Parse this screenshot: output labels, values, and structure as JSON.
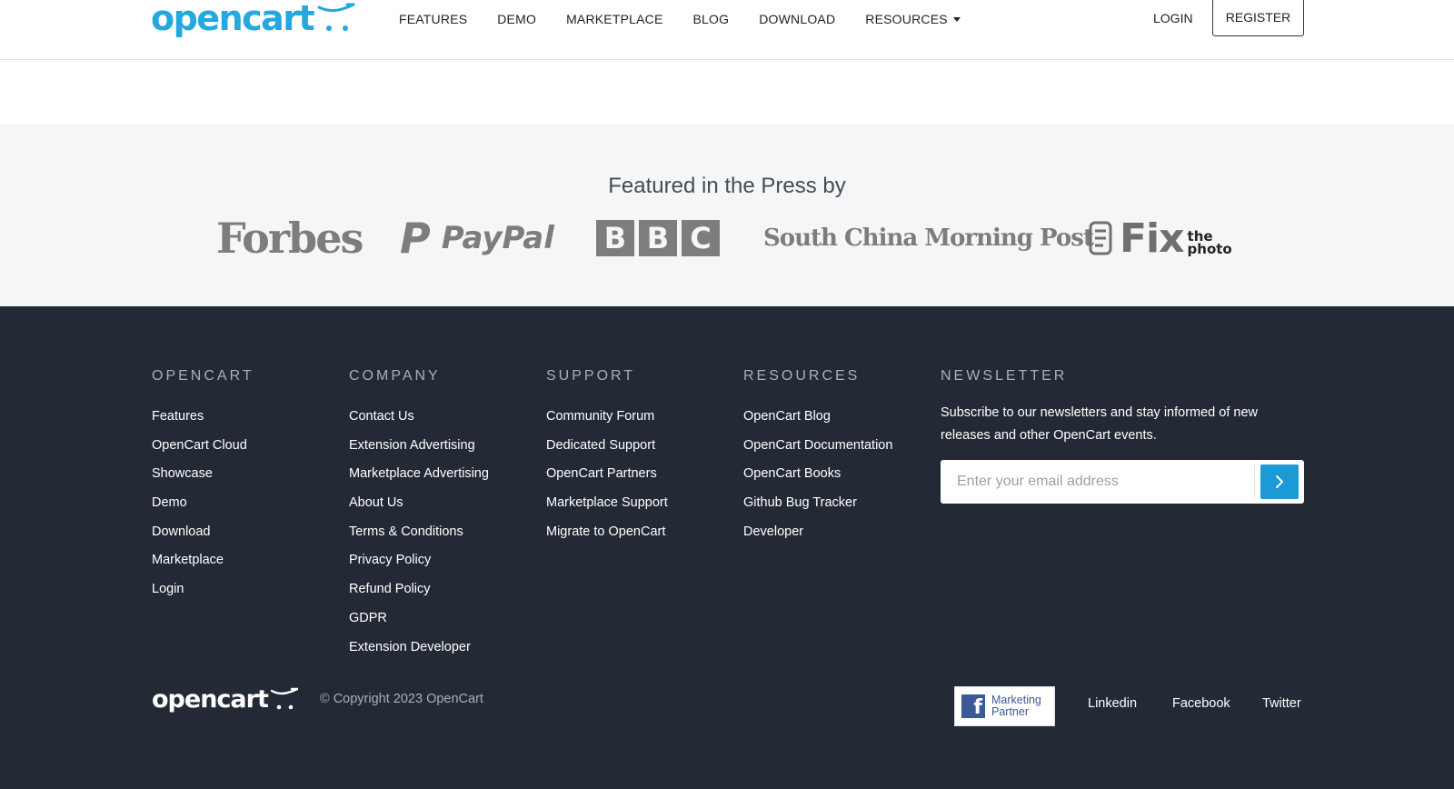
{
  "header": {
    "logo_text": "opencart",
    "nav": [
      "FEATURES",
      "DEMO",
      "MARKETPLACE",
      "BLOG",
      "DOWNLOAD",
      "RESOURCES"
    ],
    "login_label": "LOGIN",
    "register_label": "REGISTER"
  },
  "press": {
    "title": "Featured in the Press by",
    "forbes": "Forbes",
    "paypal": "PayPal",
    "paypal_mark": "P",
    "bbc": [
      "B",
      "B",
      "C"
    ],
    "scmp": "South China Morning Post",
    "fix_word": "Fix",
    "fix_small_1": "the",
    "fix_small_2": "photo"
  },
  "footer": {
    "columns": [
      {
        "title": "OPENCART",
        "links": [
          "Features",
          "OpenCart Cloud",
          "Showcase",
          "Demo",
          "Download",
          "Marketplace",
          "Login"
        ]
      },
      {
        "title": "COMPANY",
        "links": [
          "Contact Us",
          "Extension Advertising",
          "Marketplace Advertising",
          "About Us",
          "Terms & Conditions",
          "Privacy Policy",
          "Refund Policy",
          "GDPR",
          "Extension Developer"
        ]
      },
      {
        "title": "SUPPORT",
        "links": [
          "Community Forum",
          "Dedicated Support",
          "OpenCart Partners",
          "Marketplace Support",
          "Migrate to OpenCart"
        ]
      },
      {
        "title": "RESOURCES",
        "links": [
          "OpenCart Blog",
          "OpenCart Documentation",
          "OpenCart Books",
          "Github Bug Tracker",
          "Developer"
        ]
      }
    ],
    "newsletter": {
      "title": "NEWSLETTER",
      "text": "Subscribe to our newsletters and stay informed of new releases and other OpenCart events.",
      "placeholder": "Enter your email address"
    },
    "logo_text": "opencart",
    "copyright": "© Copyright 2023 OpenCart",
    "fb_badge": {
      "mark": "f",
      "line1": "Marketing",
      "line2": "Partner"
    },
    "social": [
      "Linkedin",
      "Facebook",
      "Twitter"
    ]
  },
  "colors": {
    "brand_blue": "#23a8e0",
    "footer_bg": "#242a35",
    "press_bg": "#f5f6f7",
    "button_blue": "#1b9ad6",
    "facebook_blue": "#3b5998"
  },
  "icons": [
    "cart-icon",
    "caret-down-icon",
    "chevron-right-icon",
    "facebook-icon"
  ]
}
